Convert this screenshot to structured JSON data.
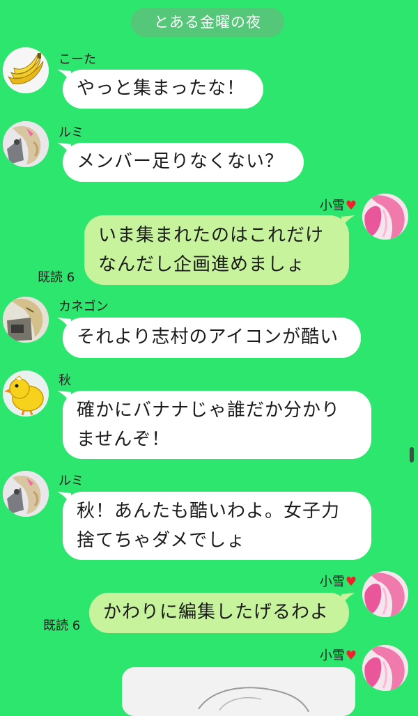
{
  "header": {
    "title": "とある金曜の夜"
  },
  "messages": [
    {
      "sender": "こーた",
      "avatar": "banana-avatar",
      "direction": "in",
      "text": "やっと集まったな！"
    },
    {
      "sender": "ルミ",
      "avatar": "anime-girl-avatar",
      "direction": "in",
      "text": "メンバー足りなくない？"
    },
    {
      "sender": "小雪",
      "sender_suffix_icon": "heart-icon",
      "avatar": "pink-hair-avatar",
      "direction": "out",
      "text": "いま集まれたのはこれだけ\nなんだし企画進めましょ",
      "read": "既読 6"
    },
    {
      "sender": "カネゴン",
      "avatar": "monster-avatar",
      "direction": "in",
      "text": "それより志村のアイコンが酷い"
    },
    {
      "sender": "秋",
      "avatar": "chick-avatar",
      "direction": "in",
      "text": "確かにバナナじゃ誰だか分かり\nませんぞ！"
    },
    {
      "sender": "ルミ",
      "avatar": "anime-girl-avatar",
      "direction": "in",
      "text": "秋！あんたも酷いわよ。女子力\n捨てちゃダメでしょ"
    },
    {
      "sender": "小雪",
      "sender_suffix_icon": "heart-icon",
      "avatar": "pink-hair-avatar",
      "direction": "out",
      "text": "かわりに編集したげるわよ",
      "read": "既読 6"
    },
    {
      "sender": "小雪",
      "sender_suffix_icon": "heart-icon",
      "avatar": "pink-hair-avatar",
      "direction": "out",
      "type": "image"
    }
  ],
  "icons": {
    "heart": "♥"
  },
  "colors": {
    "background": "#2ce66d",
    "header_pill": "#54c779",
    "incoming_bubble": "#ffffff",
    "outgoing_bubble": "#c6f39b",
    "heart": "#f0202a"
  }
}
